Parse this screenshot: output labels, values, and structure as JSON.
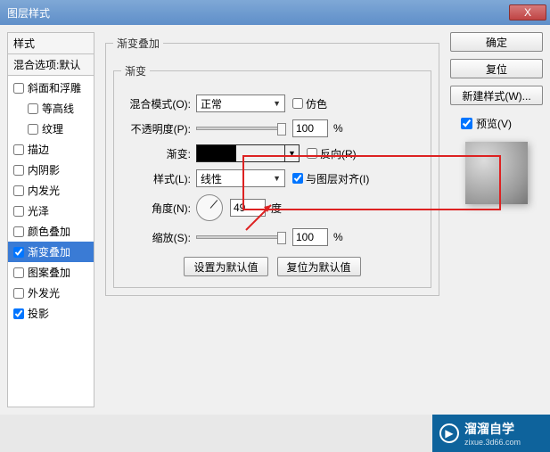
{
  "window": {
    "title": "图层样式",
    "close_icon": "X"
  },
  "sidebar": {
    "header": "样式",
    "blend_opts": "混合选项:默认",
    "items": [
      {
        "label": "斜面和浮雕",
        "checked": false
      },
      {
        "label": "等高线",
        "checked": false,
        "sub": true
      },
      {
        "label": "纹理",
        "checked": false,
        "sub": true
      },
      {
        "label": "描边",
        "checked": false
      },
      {
        "label": "内阴影",
        "checked": false
      },
      {
        "label": "内发光",
        "checked": false
      },
      {
        "label": "光泽",
        "checked": false
      },
      {
        "label": "颜色叠加",
        "checked": false
      },
      {
        "label": "渐变叠加",
        "checked": true,
        "selected": true
      },
      {
        "label": "图案叠加",
        "checked": false
      },
      {
        "label": "外发光",
        "checked": false
      },
      {
        "label": "投影",
        "checked": true
      }
    ]
  },
  "panel": {
    "outer_title": "渐变叠加",
    "inner_title": "渐变",
    "blend_mode": {
      "label": "混合模式(O):",
      "value": "正常"
    },
    "dither": {
      "label": "仿色"
    },
    "opacity": {
      "label": "不透明度(P):",
      "value": "100",
      "unit": "%"
    },
    "gradient": {
      "label": "渐变:"
    },
    "reverse": {
      "label": "反向(R)"
    },
    "style": {
      "label": "样式(L):",
      "value": "线性"
    },
    "align": {
      "label": "与图层对齐(I)"
    },
    "angle": {
      "label": "角度(N):",
      "value": "49",
      "unit": "度"
    },
    "scale": {
      "label": "缩放(S):",
      "value": "100",
      "unit": "%"
    },
    "set_default": "设置为默认值",
    "reset_default": "复位为默认值"
  },
  "right": {
    "ok": "确定",
    "cancel": "复位",
    "new_style": "新建样式(W)...",
    "preview": "预览(V)"
  },
  "watermark": {
    "name": "溜溜自学",
    "url": "zixue.3d66.com"
  }
}
